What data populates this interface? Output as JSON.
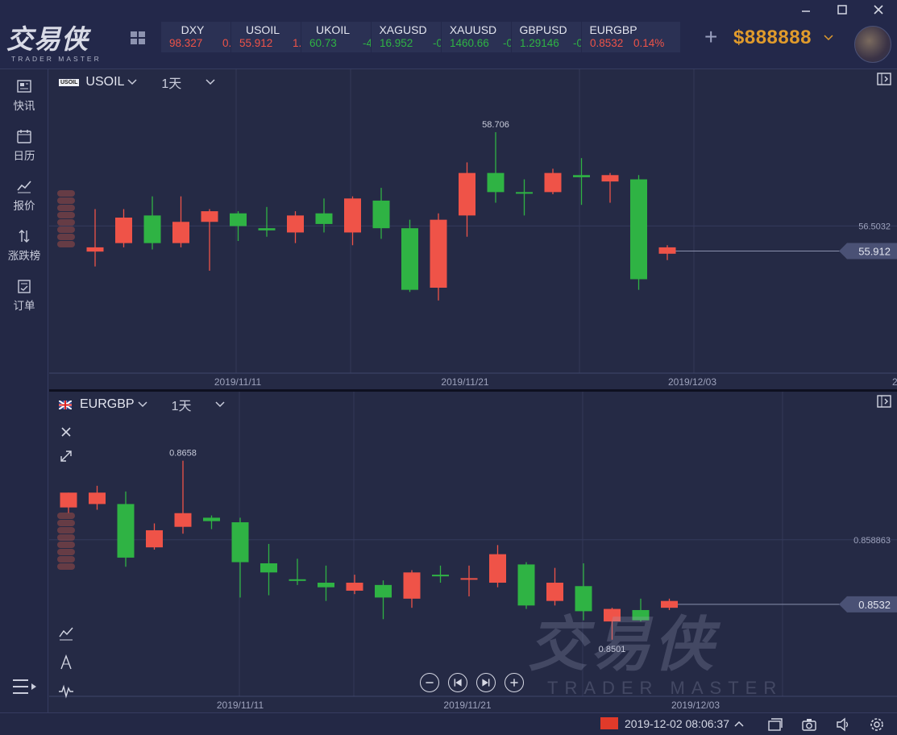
{
  "app": {
    "logo_cn": "交易侠",
    "logo_en": "TRADER MASTER",
    "balance": "$888888"
  },
  "tickers": [
    {
      "symbol": "DXY",
      "price": "98.327",
      "change": "0.",
      "dir": "down"
    },
    {
      "symbol": "USOIL",
      "price": "55.912",
      "change": "1.",
      "dir": "down"
    },
    {
      "symbol": "UKOIL",
      "price": "60.73",
      "change": "-4.",
      "dir": "up"
    },
    {
      "symbol": "XAGUSD",
      "price": "16.952",
      "change": "-0.",
      "dir": "up"
    },
    {
      "symbol": "XAUUSD",
      "price": "1460.66",
      "change": "-0.",
      "dir": "up"
    },
    {
      "symbol": "GBPUSD",
      "price": "1.29146",
      "change": "-0.",
      "dir": "up"
    },
    {
      "symbol": "EURGBP",
      "price": "0.8532",
      "change": "0.14%",
      "dir": "down"
    }
  ],
  "sidebar": {
    "items": [
      {
        "label": "快讯",
        "icon": "news-icon"
      },
      {
        "label": "日历",
        "icon": "calendar-icon"
      },
      {
        "label": "报价",
        "icon": "quote-icon"
      },
      {
        "label": "涨跌榜",
        "icon": "ranking-icon"
      },
      {
        "label": "订单",
        "icon": "order-icon"
      }
    ]
  },
  "chart_top": {
    "badge": "USOIL",
    "symbol": "USOIL",
    "timeframe": "1天",
    "high_label": "58.706",
    "gridline_label": "56.5032",
    "last_price": "55.912",
    "x_labels": [
      "2019/11/11",
      "2019/11/21",
      "2019/12/03",
      "2"
    ]
  },
  "chart_bot": {
    "symbol": "EURGBP",
    "timeframe": "1天",
    "high_label": "0.8658",
    "low_label": "0.8501",
    "gridline_label": "0.858863",
    "last_price": "0.8532",
    "x_labels": [
      "2019/11/11",
      "2019/11/21",
      "2019/12/03"
    ]
  },
  "chart_data": [
    {
      "type": "candlestick",
      "title": "USOIL",
      "timeframe": "1天",
      "candles": [
        {
          "o": 56.0,
          "h": 56.9,
          "l": 55.55,
          "c": 55.9,
          "dir": "down"
        },
        {
          "o": 56.7,
          "h": 56.9,
          "l": 56.0,
          "c": 56.1,
          "dir": "down"
        },
        {
          "o": 56.1,
          "h": 57.2,
          "l": 55.95,
          "c": 56.75,
          "dir": "up"
        },
        {
          "o": 56.6,
          "h": 57.2,
          "l": 56.0,
          "c": 56.1,
          "dir": "down"
        },
        {
          "o": 56.85,
          "h": 56.9,
          "l": 55.45,
          "c": 56.6,
          "dir": "down"
        },
        {
          "o": 56.5,
          "h": 56.85,
          "l": 56.15,
          "c": 56.8,
          "dir": "up"
        },
        {
          "o": 56.4,
          "h": 56.95,
          "l": 56.25,
          "c": 56.45,
          "dir": "up"
        },
        {
          "o": 56.75,
          "h": 56.85,
          "l": 56.1,
          "c": 56.35,
          "dir": "down"
        },
        {
          "o": 56.55,
          "h": 57.15,
          "l": 56.35,
          "c": 56.8,
          "dir": "up"
        },
        {
          "o": 57.15,
          "h": 57.2,
          "l": 56.05,
          "c": 56.35,
          "dir": "down"
        },
        {
          "o": 56.45,
          "h": 57.4,
          "l": 56.2,
          "c": 57.1,
          "dir": "up"
        },
        {
          "o": 55.0,
          "h": 56.65,
          "l": 54.95,
          "c": 56.45,
          "dir": "up"
        },
        {
          "o": 56.65,
          "h": 56.8,
          "l": 54.75,
          "c": 55.05,
          "dir": "down"
        },
        {
          "o": 57.75,
          "h": 58.0,
          "l": 56.25,
          "c": 56.75,
          "dir": "down"
        },
        {
          "o": 57.3,
          "h": 58.71,
          "l": 57.05,
          "c": 57.75,
          "dir": "up"
        },
        {
          "o": 57.3,
          "h": 57.6,
          "l": 56.75,
          "c": 57.3,
          "dir": "up"
        },
        {
          "o": 57.75,
          "h": 57.85,
          "l": 57.25,
          "c": 57.3,
          "dir": "down"
        },
        {
          "o": 57.65,
          "h": 58.1,
          "l": 57.0,
          "c": 57.7,
          "dir": "up"
        },
        {
          "o": 57.7,
          "h": 57.75,
          "l": 57.05,
          "c": 57.55,
          "dir": "down"
        },
        {
          "o": 55.25,
          "h": 57.7,
          "l": 55.0,
          "c": 57.6,
          "dir": "up"
        },
        {
          "o": 56.0,
          "h": 56.05,
          "l": 55.7,
          "c": 55.85,
          "dir": "down"
        }
      ],
      "y_gridline": 56.5032,
      "last_price": 55.912
    },
    {
      "type": "candlestick",
      "title": "EURGBP",
      "timeframe": "1天",
      "candles": [
        {
          "o": 0.863,
          "h": 0.863,
          "l": 0.8612,
          "c": 0.8617,
          "dir": "down"
        },
        {
          "o": 0.863,
          "h": 0.8636,
          "l": 0.8615,
          "c": 0.862,
          "dir": "down"
        },
        {
          "o": 0.8573,
          "h": 0.8631,
          "l": 0.8565,
          "c": 0.862,
          "dir": "up"
        },
        {
          "o": 0.8597,
          "h": 0.8603,
          "l": 0.858,
          "c": 0.8582,
          "dir": "down"
        },
        {
          "o": 0.8612,
          "h": 0.8658,
          "l": 0.8594,
          "c": 0.86,
          "dir": "down"
        },
        {
          "o": 0.8605,
          "h": 0.861,
          "l": 0.8598,
          "c": 0.8608,
          "dir": "up"
        },
        {
          "o": 0.8569,
          "h": 0.8608,
          "l": 0.8538,
          "c": 0.8604,
          "dir": "up"
        },
        {
          "o": 0.856,
          "h": 0.8585,
          "l": 0.854,
          "c": 0.8568,
          "dir": "up"
        },
        {
          "o": 0.8554,
          "h": 0.8572,
          "l": 0.8549,
          "c": 0.8554,
          "dir": "up"
        },
        {
          "o": 0.8547,
          "h": 0.8566,
          "l": 0.8535,
          "c": 0.8551,
          "dir": "up"
        },
        {
          "o": 0.8551,
          "h": 0.8558,
          "l": 0.8541,
          "c": 0.8544,
          "dir": "down"
        },
        {
          "o": 0.8538,
          "h": 0.8553,
          "l": 0.8519,
          "c": 0.8549,
          "dir": "up"
        },
        {
          "o": 0.856,
          "h": 0.8562,
          "l": 0.8529,
          "c": 0.8537,
          "dir": "down"
        },
        {
          "o": 0.8557,
          "h": 0.8566,
          "l": 0.8551,
          "c": 0.8558,
          "dir": "up"
        },
        {
          "o": 0.8555,
          "h": 0.8566,
          "l": 0.8539,
          "c": 0.8554,
          "dir": "down"
        },
        {
          "o": 0.8576,
          "h": 0.8584,
          "l": 0.8547,
          "c": 0.8551,
          "dir": "down"
        },
        {
          "o": 0.8531,
          "h": 0.8569,
          "l": 0.8528,
          "c": 0.8567,
          "dir": "up"
        },
        {
          "o": 0.8551,
          "h": 0.8564,
          "l": 0.8531,
          "c": 0.8535,
          "dir": "down"
        },
        {
          "o": 0.8526,
          "h": 0.8568,
          "l": 0.8518,
          "c": 0.8548,
          "dir": "up"
        },
        {
          "o": 0.8528,
          "h": 0.8529,
          "l": 0.8501,
          "c": 0.8517,
          "dir": "down"
        },
        {
          "o": 0.8518,
          "h": 0.8537,
          "l": 0.8517,
          "c": 0.8527,
          "dir": "up"
        },
        {
          "o": 0.8535,
          "h": 0.8537,
          "l": 0.8527,
          "c": 0.8529,
          "dir": "down"
        }
      ],
      "y_gridline": 0.858863,
      "last_price": 0.8532
    }
  ],
  "status": {
    "datetime": "2019-12-02 08:06:37",
    "colors": {
      "up": "#2fb344",
      "down": "#ef5348"
    }
  }
}
